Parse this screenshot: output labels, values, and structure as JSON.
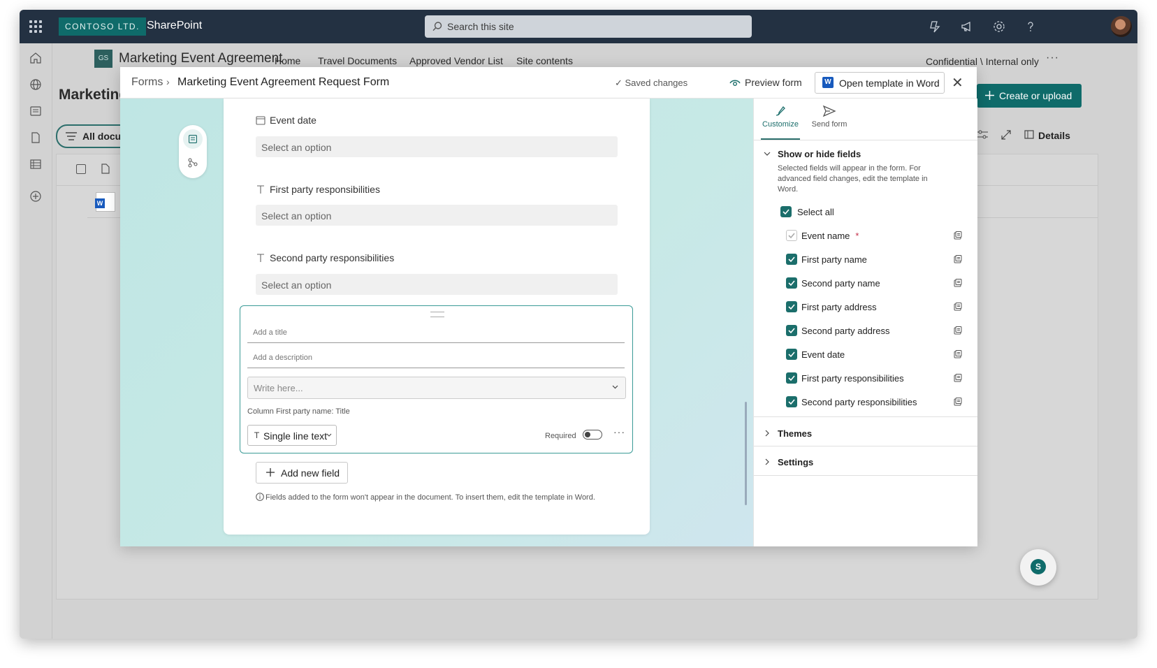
{
  "topbar": {
    "brand": "CONTOSO LTD.",
    "app_name": "SharePoint",
    "search_placeholder": "Search this site"
  },
  "site": {
    "icon_initials": "GS",
    "title": "Marketing Event Agreement",
    "nav": [
      "Home",
      "Travel Documents",
      "Approved Vendor List",
      "Site contents"
    ],
    "active_nav": "Travel Documents",
    "classification": "Confidential \\ Internal only",
    "page_title_partial": "Marketing",
    "all_docs_partial": "All docum",
    "create_button": "Create or upload",
    "details_button": "Details"
  },
  "modal": {
    "breadcrumb_root": "Forms",
    "breadcrumb_current": "Marketing Event Agreement Request Form",
    "saved_status": "Saved changes",
    "preview_button": "Preview form",
    "open_word_button": "Open template in Word",
    "fields": [
      {
        "label": "Event date",
        "placeholder": "Select an option",
        "icon": "calendar-icon"
      },
      {
        "label": "First party responsibilities",
        "placeholder": "Select an option",
        "icon": "text-type-icon"
      },
      {
        "label": "Second party responsibilities",
        "placeholder": "Select an option",
        "icon": "text-type-icon"
      }
    ],
    "editor": {
      "title_placeholder": "Add a title",
      "description_placeholder": "Add a description",
      "write_placeholder": "Write here...",
      "column_info": "Column First party name: Title",
      "type_label": "Single line text",
      "required_label": "Required",
      "required_on": false
    },
    "add_field_button": "Add new field",
    "note": "Fields added to the form won't appear in the document. To insert them, edit the template in Word."
  },
  "panel": {
    "tabs": [
      "Customize",
      "Send form"
    ],
    "active_tab": "Customize",
    "section_fields": {
      "title": "Show or hide fields",
      "description": "Selected fields will appear in the form. For advanced field changes, edit the template in Word.",
      "select_all": "Select all",
      "items": [
        {
          "label": "Event name",
          "required": true,
          "checked": true,
          "disabled": true
        },
        {
          "label": "First party name",
          "checked": true
        },
        {
          "label": "Second party name",
          "checked": true
        },
        {
          "label": "First party address",
          "checked": true
        },
        {
          "label": "Second party address",
          "checked": true
        },
        {
          "label": "Event date",
          "checked": true
        },
        {
          "label": "First party responsibilities",
          "checked": true
        },
        {
          "label": "Second party responsibilities",
          "checked": true
        }
      ],
      "required_marker": "*"
    },
    "section_themes": "Themes",
    "section_settings": "Settings"
  },
  "colors": {
    "accent": "#1b6e6b",
    "topbar": "#233142",
    "canvas": "#c2e7e4"
  }
}
